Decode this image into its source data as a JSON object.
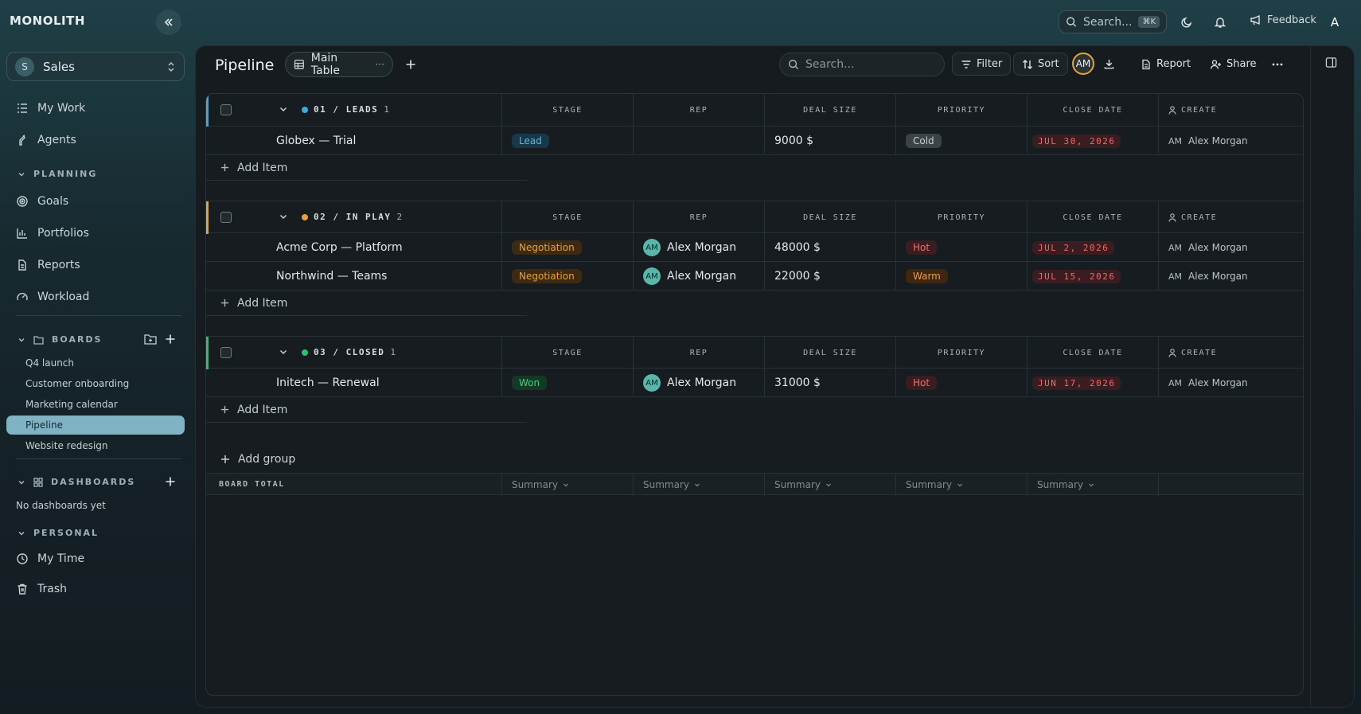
{
  "app": {
    "logo": "MONOLITH",
    "user_initial": "A"
  },
  "topbar": {
    "search_placeholder": "Search...",
    "search_shortcut": "⌘K",
    "feedback_label": "Feedback"
  },
  "colors": {
    "accent": "#7fb3c4",
    "leads": "#3ea8e0",
    "in_play": "#e8a23a",
    "closed": "#2fbf71",
    "date_red": "#ef6a6a"
  },
  "sidebar": {
    "workspace": {
      "initial": "S",
      "name": "Sales"
    },
    "nav": [
      {
        "label": "My Work",
        "icon": "list-icon"
      },
      {
        "label": "Agents",
        "icon": "agent-icon"
      }
    ],
    "planning": {
      "title": "PLANNING",
      "items": [
        {
          "label": "Goals",
          "icon": "target-icon"
        },
        {
          "label": "Portfolios",
          "icon": "bar-chart-icon"
        },
        {
          "label": "Reports",
          "icon": "document-icon"
        },
        {
          "label": "Workload",
          "icon": "gauge-icon"
        }
      ]
    },
    "boards": {
      "title": "BOARDS",
      "items": [
        "Q4 launch",
        "Customer onboarding",
        "Marketing calendar",
        "Pipeline",
        "Website redesign"
      ],
      "active": "Pipeline"
    },
    "dashboards": {
      "title": "DASHBOARDS",
      "empty": "No dashboards yet"
    },
    "personal": {
      "title": "PERSONAL",
      "items": [
        {
          "label": "My Time",
          "icon": "clock-icon"
        },
        {
          "label": "Trash",
          "icon": "trash-icon"
        }
      ]
    }
  },
  "toolbar": {
    "title": "Pipeline",
    "view_label": "Main Table",
    "view_menu": "···",
    "search_placeholder": "Search...",
    "filter_label": "Filter",
    "sort_label": "Sort",
    "avatar_initials": "AM",
    "report_label": "Report",
    "share_label": "Share"
  },
  "table": {
    "columns": [
      "STAGE",
      "REP",
      "DEAL SIZE",
      "PRIORITY",
      "CLOSE DATE",
      "CREATE"
    ],
    "add_item_label": "Add Item",
    "add_group_label": "Add group",
    "total_label": "BOARD TOTAL",
    "summary_label": "Summary",
    "groups": [
      {
        "title": "01 / LEADS",
        "count": "1",
        "color": "#3ea8e0",
        "rows": [
          {
            "name": "Globex — Trial",
            "stage": "Lead",
            "rep": "",
            "rep_initials": "",
            "deal": "9000 $",
            "priority": "Cold",
            "date": "JUL 30, 2026",
            "created_initials": "AM",
            "created_name": "Alex Morgan"
          }
        ]
      },
      {
        "title": "02 / IN PLAY",
        "count": "2",
        "color": "#e8a23a",
        "rows": [
          {
            "name": "Acme Corp — Platform",
            "stage": "Negotiation",
            "rep": "Alex Morgan",
            "rep_initials": "AM",
            "deal": "48000 $",
            "priority": "Hot",
            "date": "JUL 2, 2026",
            "created_initials": "AM",
            "created_name": "Alex Morgan"
          },
          {
            "name": "Northwind — Teams",
            "stage": "Negotiation",
            "rep": "Alex Morgan",
            "rep_initials": "AM",
            "deal": "22000 $",
            "priority": "Warm",
            "date": "JUL 15, 2026",
            "created_initials": "AM",
            "created_name": "Alex Morgan"
          }
        ]
      },
      {
        "title": "03 / CLOSED",
        "count": "1",
        "color": "#2fbf71",
        "rows": [
          {
            "name": "Initech — Renewal",
            "stage": "Won",
            "rep": "Alex Morgan",
            "rep_initials": "AM",
            "deal": "31000 $",
            "priority": "Hot",
            "date": "JUN 17, 2026",
            "created_initials": "AM",
            "created_name": "Alex Morgan"
          }
        ]
      }
    ]
  }
}
